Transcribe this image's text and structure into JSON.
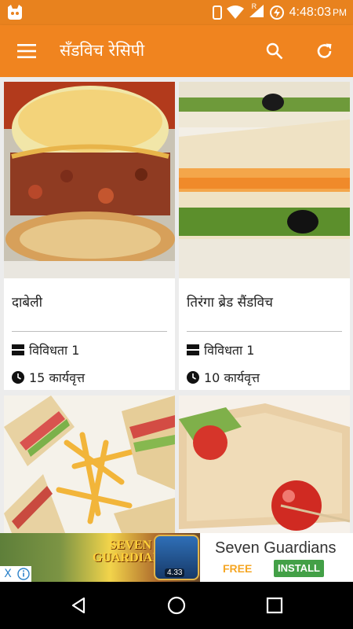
{
  "status_bar": {
    "time": "4:48:03",
    "ampm": "PM",
    "network_letter": "R"
  },
  "app_bar": {
    "title": "सॅंडविच रेसिपी",
    "menu_icon": "hamburger-menu-icon",
    "search_icon": "search-icon",
    "refresh_icon": "refresh-icon"
  },
  "recipes": [
    {
      "name": "दाबेली",
      "variety": "विविधता 1",
      "time": "15 कार्यवृत्त"
    },
    {
      "name": "तिरंगा ब्रेड सैंडविच",
      "variety": "विविधता 1",
      "time": "10 कार्यवृत्त"
    },
    {
      "name": "",
      "variety": "",
      "time": ""
    },
    {
      "name": "",
      "variety": "",
      "time": ""
    }
  ],
  "ad": {
    "logo_line1": "SEVEN",
    "logo_line2": "GUARDIANS",
    "badge": "4.33",
    "title": "Seven Guardians",
    "price": "FREE",
    "install_label": "INSTALL",
    "close_label": "X"
  },
  "colors": {
    "primary": "#f0841f",
    "status_bar": "#e8821e",
    "install_green": "#43a047"
  }
}
